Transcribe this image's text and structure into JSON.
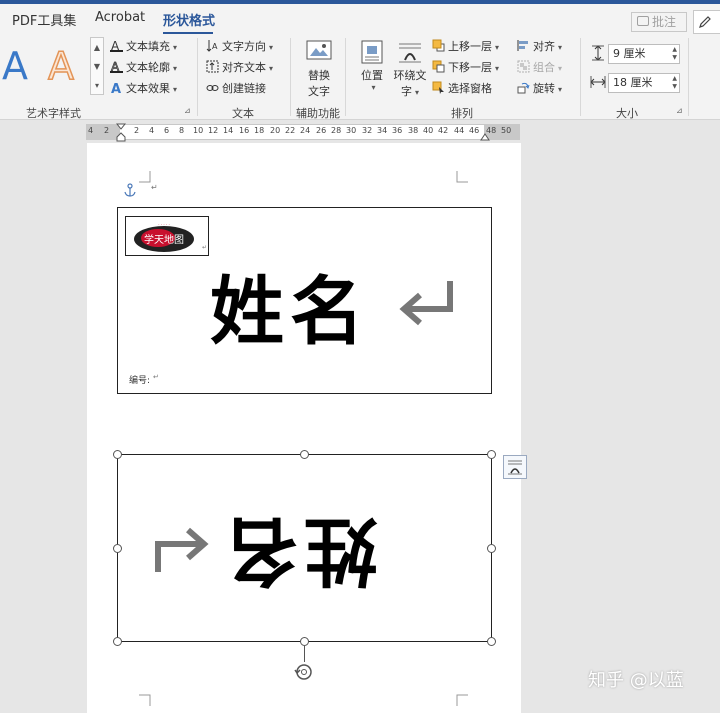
{
  "tabs": [
    "PDF工具集",
    "Acrobat",
    "形状格式"
  ],
  "active_tab": "形状格式",
  "comment_button": "批注",
  "ribbon": {
    "wordart": {
      "group_label": "艺术字样式",
      "style1_glyph": "A",
      "style2_glyph": "A",
      "text_fill": "文本填充",
      "text_outline": "文本轮廓",
      "text_effects": "文本效果",
      "colors": {
        "style1": "#3a79c8",
        "style2_fill": "#fbe6d4",
        "style2_outline": "#e39457"
      }
    },
    "text": {
      "group_label": "文本",
      "text_direction": "文字方向",
      "align_text": "对齐文本",
      "create_link": "创建链接"
    },
    "accessibility": {
      "group_label": "辅助功能",
      "alt_text_line1": "替换",
      "alt_text_line2": "文字"
    },
    "arrange": {
      "group_label": "排列",
      "position": "位置",
      "wrap_text_line1": "环绕文",
      "wrap_text_line2": "字",
      "bring_forward": "上移一层",
      "send_backward": "下移一层",
      "selection_pane": "选择窗格",
      "align": "对齐",
      "group": "组合",
      "rotate": "旋转"
    },
    "size": {
      "group_label": "大小",
      "height": "9 厘米",
      "width": "18 厘米"
    }
  },
  "ruler": {
    "numbers": [
      "4",
      "2",
      "2",
      "4",
      "6",
      "8",
      "10",
      "12",
      "14",
      "16",
      "18",
      "20",
      "22",
      "24",
      "26",
      "28",
      "30",
      "32",
      "34",
      "36",
      "38",
      "40",
      "42",
      "44",
      "46",
      "48",
      "50"
    ]
  },
  "document": {
    "name_text": "姓名",
    "number_label": "编号:",
    "paragraph_mark": "↵",
    "logo_text": "学天地图"
  },
  "watermark": "知乎 @以蓝",
  "colors": {
    "accent": "#2b579a",
    "ribbon_bg": "#f3f3f3"
  }
}
